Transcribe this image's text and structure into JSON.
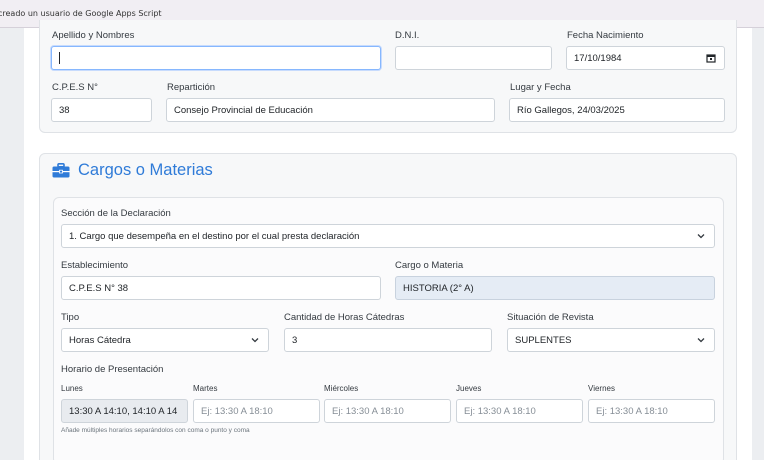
{
  "banner": {
    "text": "creado un usuario de Google Apps Script"
  },
  "personal": {
    "apellido_label": "Apellido y Nombres",
    "apellido_value": "",
    "dni_label": "D.N.I.",
    "dni_value": "",
    "fecha_nac_label": "Fecha Nacimiento",
    "fecha_nac_value": "17/10/1984",
    "cpes_label": "C.P.E.S N°",
    "cpes_value": "38",
    "reparticion_label": "Repartición",
    "reparticion_value": "Consejo Provincial de Educación",
    "lugar_fecha_label": "Lugar y Fecha",
    "lugar_fecha_value": "Río Gallegos, 24/03/2025"
  },
  "cargos": {
    "title": "Cargos o Materias",
    "seccion_label": "Sección de la Declaración",
    "seccion_value": "1. Cargo que desempeña en el destino por el cual presta declaración",
    "establecimiento_label": "Establecimiento",
    "establecimiento_value": "C.P.E.S N° 38",
    "cargo_label": "Cargo o Materia",
    "cargo_value": "HISTORIA (2° A)",
    "tipo_label": "Tipo",
    "tipo_value": "Horas Cátedra",
    "horas_label": "Cantidad de Horas Cátedras",
    "horas_value": "3",
    "revista_label": "Situación de Revista",
    "revista_value": "SUPLENTES",
    "horario_label": "Horario de Presentación",
    "days": [
      {
        "label": "Lunes",
        "value": "13:30 A 14:10, 14:10 A 14",
        "placeholder": ""
      },
      {
        "label": "Martes",
        "value": "",
        "placeholder": "Ej: 13:30 A 18:10"
      },
      {
        "label": "Miércoles",
        "value": "",
        "placeholder": "Ej: 13:30 A 18:10"
      },
      {
        "label": "Jueves",
        "value": "",
        "placeholder": "Ej: 13:30 A 18:10"
      },
      {
        "label": "Viernes",
        "value": "",
        "placeholder": "Ej: 13:30 A 18:10"
      }
    ],
    "hint": "Añade múltiples horarios separándolos con coma o punto y coma"
  },
  "colors": {
    "accent": "#2f7bd8",
    "focus_border": "#86b7fe",
    "readonly_bg": "#e5ecf5"
  },
  "icons": {
    "section_icon": "briefcase-icon"
  }
}
